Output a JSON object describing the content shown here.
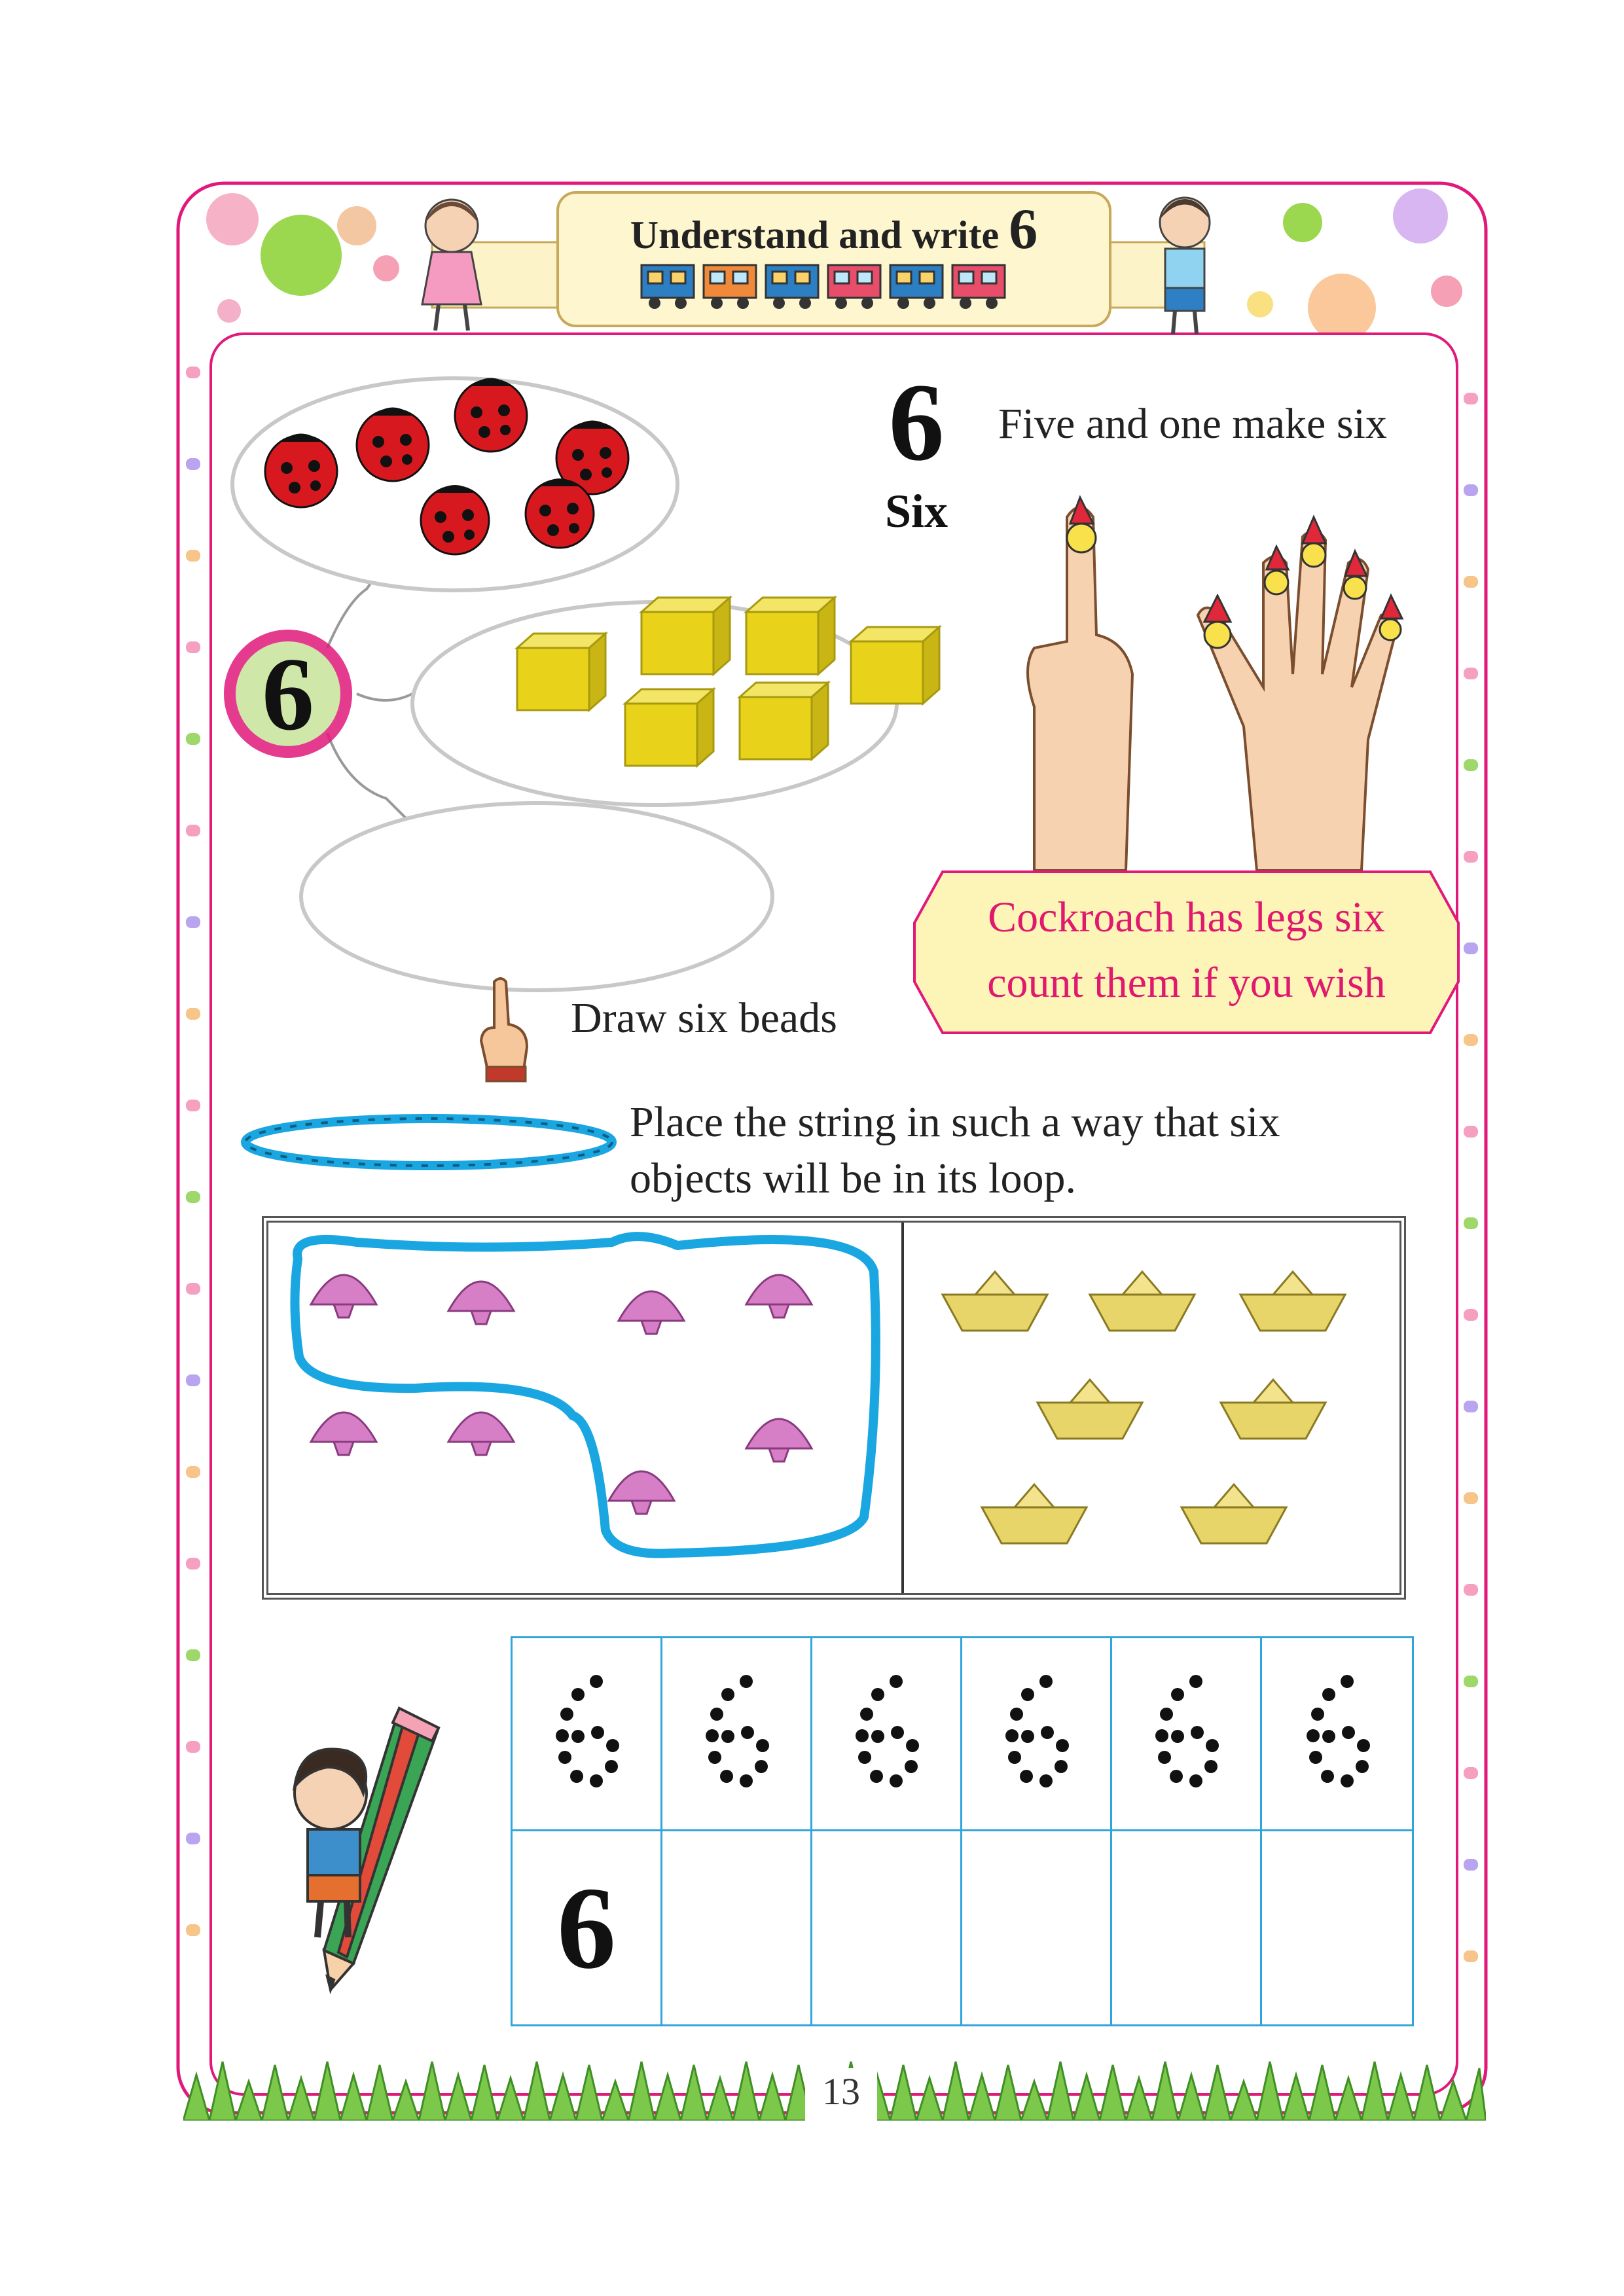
{
  "header": {
    "title": "Understand and write",
    "title_number": "6"
  },
  "intro": {
    "numeral": "6",
    "word": "Six",
    "caption": "Five and one make six"
  },
  "concept_web": {
    "center_number": "6",
    "items": [
      {
        "label": "ladybug",
        "count": 6
      },
      {
        "label": "yellow-cube",
        "count": 6
      },
      {
        "label": "empty-oval",
        "count": 0
      }
    ]
  },
  "rhyme": {
    "line1": "Cockroach has legs six",
    "line2": "count them if you wish"
  },
  "activity_beads": {
    "instruction": "Draw six beads"
  },
  "activity_string": {
    "instruction_line1": "Place the string in such a way that six",
    "instruction_line2": "objects will be in its loop."
  },
  "panels": {
    "left_item": "shell",
    "left_count": 8,
    "right_item": "paper-boat",
    "right_count": 7
  },
  "tracing": {
    "dotted_digits": [
      "6",
      "6",
      "6",
      "6",
      "6",
      "6"
    ],
    "first_written": "6"
  },
  "footer": {
    "page_number": "13"
  },
  "colors": {
    "page_border": "#e0197a",
    "rhyme_text": "#e0196e",
    "grid_lines": "#2fa5db",
    "string_loop": "#1aa6e0",
    "ladybug_red": "#d7191f",
    "cube_yellow": "#e8d21a"
  }
}
